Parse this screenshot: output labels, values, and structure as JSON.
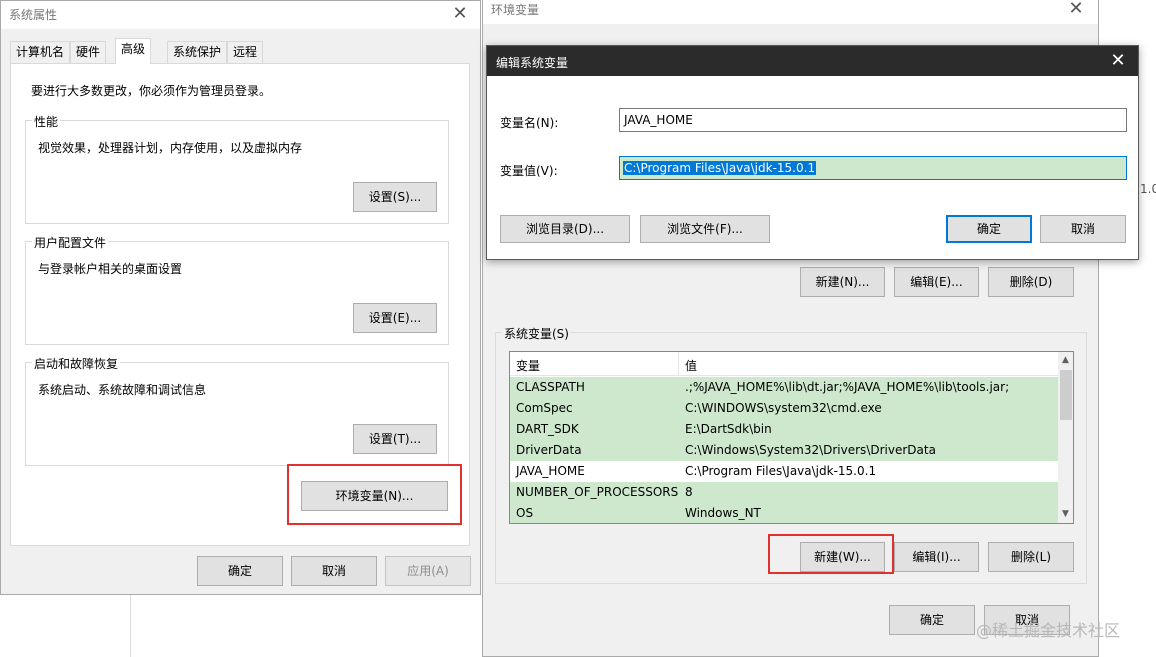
{
  "sysprops": {
    "title": "系统属性",
    "close": "✕",
    "tabs": [
      "计算机名",
      "硬件",
      "高级",
      "系统保护",
      "远程"
    ],
    "admin_note": "要进行大多数更改，你必须作为管理员登录。",
    "perf": {
      "label": "性能",
      "desc": "视觉效果，处理器计划，内存使用，以及虚拟内存",
      "button": "设置(S)..."
    },
    "profile": {
      "label": "用户配置文件",
      "desc": "与登录帐户相关的桌面设置",
      "button": "设置(E)..."
    },
    "startup": {
      "label": "启动和故障恢复",
      "desc": "系统启动、系统故障和调试信息",
      "button": "设置(T)..."
    },
    "env_button": "环境变量(N)...",
    "ok": "确定",
    "cancel": "取消",
    "apply": "应用(A)"
  },
  "envvars": {
    "title": "环境变量",
    "close": "✕",
    "user_new": "新建(N)...",
    "user_edit": "编辑(E)...",
    "user_delete": "删除(D)",
    "system_label": "系统变量(S)",
    "col_var": "变量",
    "col_val": "值",
    "rows": [
      {
        "name": "CLASSPATH",
        "value": ".;%JAVA_HOME%\\lib\\dt.jar;%JAVA_HOME%\\lib\\tools.jar;"
      },
      {
        "name": "ComSpec",
        "value": "C:\\WINDOWS\\system32\\cmd.exe"
      },
      {
        "name": "DART_SDK",
        "value": "E:\\DartSdk\\bin"
      },
      {
        "name": "DriverData",
        "value": "C:\\Windows\\System32\\Drivers\\DriverData"
      },
      {
        "name": "JAVA_HOME",
        "value": "C:\\Program Files\\Java\\jdk-15.0.1"
      },
      {
        "name": "NUMBER_OF_PROCESSORS",
        "value": "8"
      },
      {
        "name": "OS",
        "value": "Windows_NT"
      }
    ],
    "sys_new": "新建(W)...",
    "sys_edit": "编辑(I)...",
    "sys_delete": "删除(L)",
    "ok": "确定",
    "cancel": "取消"
  },
  "editvar": {
    "title": "编辑系统变量",
    "close": "✕",
    "name_label": "变量名(N):",
    "name_value": "JAVA_HOME",
    "value_label": "变量值(V):",
    "value_value": "C:\\Program Files\\Java\\jdk-15.0.1",
    "browse_dir": "浏览目录(D)...",
    "browse_file": "浏览文件(F)...",
    "ok": "确定",
    "cancel": "取消"
  },
  "background": {
    "edge_text": "1.0"
  },
  "watermark": "@稀土掘金技术社区",
  "colors": {
    "highlight_red": "#e0302f",
    "selection_green": "#cde8cd",
    "focus_blue": "#0078d7"
  }
}
